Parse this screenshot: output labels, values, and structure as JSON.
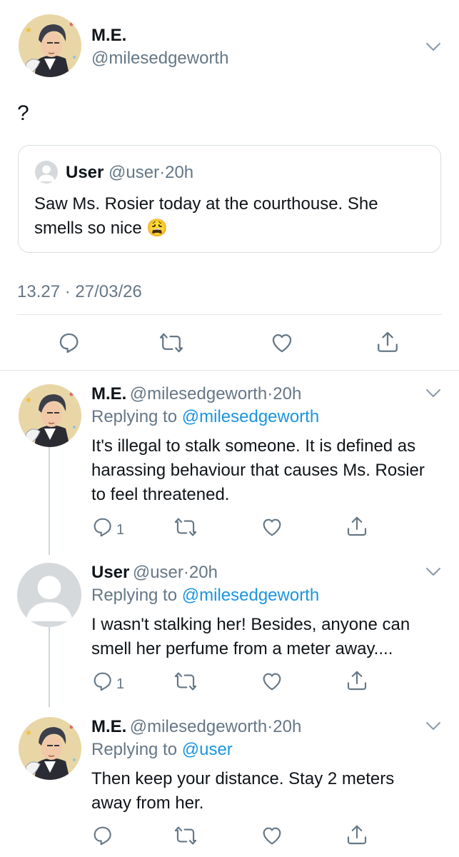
{
  "main_tweet": {
    "display_name": "M.E.",
    "handle": "@milesedgeworth",
    "text": "?",
    "timestamp": "13.27 · 27/03/26",
    "quoted": {
      "display_name": "User",
      "handle": "@user",
      "dot": "·",
      "time": "20h",
      "text_line1": "Saw Ms. Rosier today at the courthouse. She",
      "text_line2": "smells so nice",
      "emoji": "😩"
    }
  },
  "replies": [
    {
      "display_name": "M.E.",
      "handle": "@milesedgeworth",
      "dot": "·",
      "time": "20h",
      "replying_prefix": "Replying to",
      "replying_to": "@milesedgeworth",
      "text": "It's illegal to stalk someone. It is defined as harassing behaviour that causes Ms. Rosier to feel threatened.",
      "reply_count": "1"
    },
    {
      "display_name": "User",
      "handle": "@user",
      "dot": "·",
      "time": "20h",
      "replying_prefix": "Replying to",
      "replying_to": "@milesedgeworth",
      "text": "I wasn't stalking her! Besides, anyone can smell her perfume from a meter away....",
      "reply_count": "1"
    },
    {
      "display_name": "M.E.",
      "handle": "@milesedgeworth",
      "dot": "·",
      "time": "20h",
      "replying_prefix": "Replying to",
      "replying_to": "@user",
      "text": "Then keep your distance. Stay 2 meters away from her.",
      "reply_count": ""
    }
  ],
  "icons": [
    "reply-icon",
    "retweet-icon",
    "like-icon",
    "share-icon",
    "chevron-down-icon"
  ],
  "colors": {
    "link": "#1b95e0",
    "muted": "#657786",
    "divider": "#e1e8ed"
  }
}
